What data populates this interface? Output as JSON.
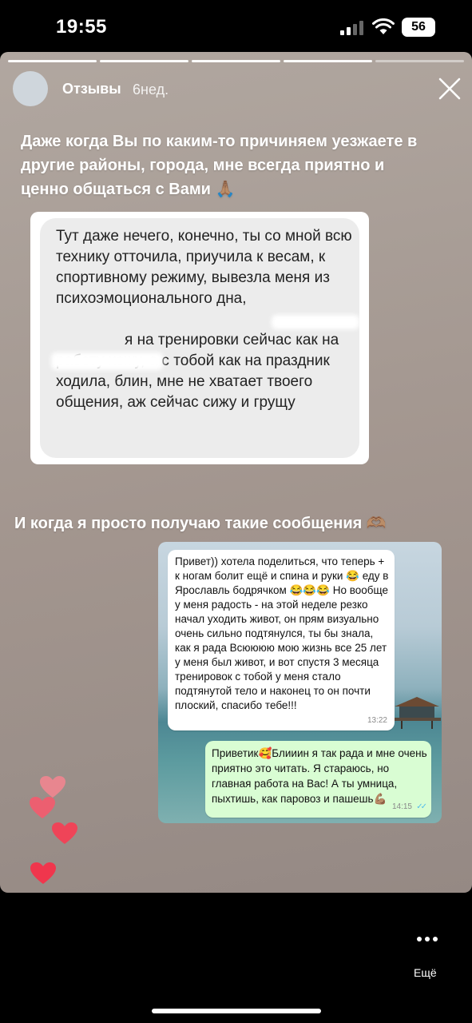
{
  "status_bar": {
    "time": "19:55",
    "battery": "56"
  },
  "story": {
    "username": "Отзывы",
    "age": "6нед.",
    "progress_segments": 5,
    "progress_active": 4,
    "caption_top": "Даже когда Вы по каким-то причиняем уезжаете в другие районы, города, мне всегда приятно и ценно общаться с Вами 🙏🏽",
    "quoted_message_paragraph1": "Тут даже нечего, конечно, ты со мной всю технику отточила, приучила к весам, к спортивному режиму, вывезла меня из психоэмоционального дна,",
    "quoted_message_paragraph2": "я на тренировки сейчас как на работу хожу, а с тобой как на праздник ходила, блин, мне не хватает твоего общения, аж сейчас сижу и грущу",
    "caption_middle": "И когда я просто получаю такие сообщения 🫶🏽",
    "chat": {
      "incoming_text": "Привет)) хотела поделиться, что теперь + к ногам болит ещё и спина и руки 😂 еду в Ярославль бодрячком 😂😂😂 Но вообще у меня радость - на этой неделе резко начал уходить живот, он прям визуально очень сильно подтянулся, ты бы знала, как я рада Всюююю мою жизнь все 25 лет у меня был живот, и вот спустя 3 месяца тренировок с тобой у меня стало подтянутой тело и наконец то он почти плоский, спасибо тебе!!!",
      "incoming_time": "13:22",
      "outgoing_text": "Приветик🥰Блииин я так рада и мне очень приятно это читать. Я стараюсь, но главная работа на Вас! А ты умница, пыхтишь, как паровоз и пашешь💪🏽",
      "outgoing_time": "14:15",
      "read_ticks": "✓✓"
    }
  },
  "bottom": {
    "more_label": "Ещё"
  },
  "colors": {
    "heart_light": "#e8868f",
    "heart_dark": "#f0364d",
    "bubble_out": "#d9fdd3",
    "read_tick": "#53bdeb"
  }
}
